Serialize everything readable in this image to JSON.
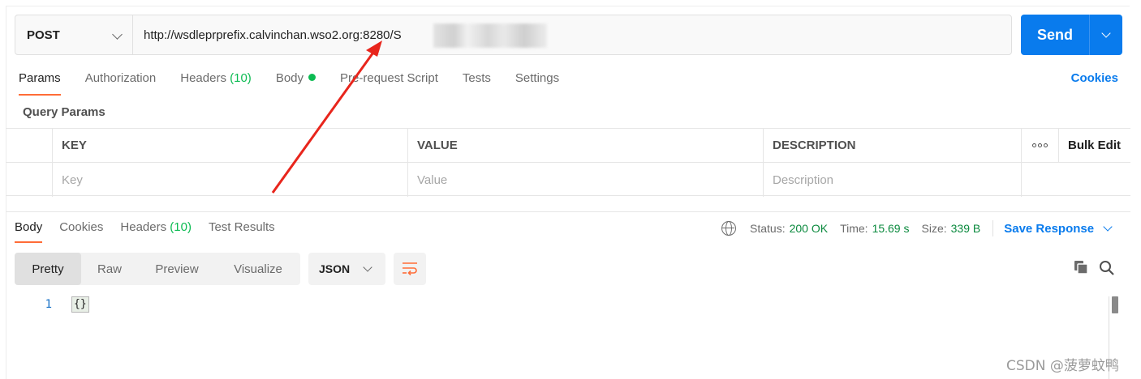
{
  "request": {
    "method": "POST",
    "url": "http://wsdleprprefix.calvinchan.wso2.org:8280/S",
    "send_label": "Send"
  },
  "request_tabs": [
    {
      "label": "Params",
      "active": true
    },
    {
      "label": "Authorization"
    },
    {
      "label": "Headers",
      "count": "(10)"
    },
    {
      "label": "Body",
      "indicator": "green-dot"
    },
    {
      "label": "Pre-request Script"
    },
    {
      "label": "Tests"
    },
    {
      "label": "Settings"
    }
  ],
  "cookies_link": "Cookies",
  "query_params": {
    "title": "Query Params",
    "headers": {
      "key": "KEY",
      "value": "VALUE",
      "description": "DESCRIPTION",
      "bulk_edit": "Bulk Edit"
    },
    "placeholders": {
      "key": "Key",
      "value": "Value",
      "description": "Description"
    }
  },
  "response_tabs": [
    {
      "label": "Body",
      "active": true
    },
    {
      "label": "Cookies"
    },
    {
      "label": "Headers",
      "count": "(10)"
    },
    {
      "label": "Test Results"
    }
  ],
  "response_status": {
    "status_label": "Status:",
    "status_value": "200 OK",
    "time_label": "Time:",
    "time_value": "15.69 s",
    "size_label": "Size:",
    "size_value": "339 B",
    "save_response": "Save Response"
  },
  "view_modes": [
    "Pretty",
    "Raw",
    "Preview",
    "Visualize"
  ],
  "active_view": "Pretty",
  "format": "JSON",
  "editor": {
    "line_number": "1",
    "content": "{}"
  },
  "watermark": "CSDN @菠萝蚊鸭",
  "colors": {
    "accent_blue": "#097bed",
    "active_tab_underline": "#ff6c37",
    "success_green": "#0cbb52",
    "annotation_arrow": "#e8251c"
  }
}
